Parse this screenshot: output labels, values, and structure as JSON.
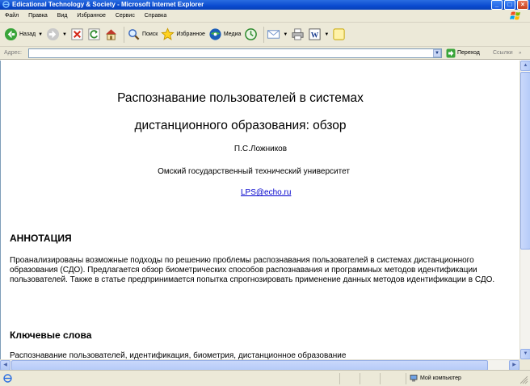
{
  "window": {
    "title": "Edicational Technology & Society - Microsoft Internet Explorer"
  },
  "menu": {
    "items": [
      "Файл",
      "Правка",
      "Вид",
      "Избранное",
      "Сервис",
      "Справка"
    ]
  },
  "toolbar": {
    "back_label": "Назад",
    "search_label": "Поиск",
    "favorites_label": "Избранное",
    "media_label": "Медиа"
  },
  "address": {
    "label": "Адрес:",
    "value": "",
    "go_label": "Переход",
    "links_label": "Ссылки"
  },
  "article": {
    "title_line1": "Распознавание пользователей в системах",
    "title_line2": "дистанционного образования: обзор",
    "author": "П.С.Ложников",
    "affiliation": "Омский государственный технический университет",
    "email": "LPS@echo.ru",
    "abstract_heading": "АННОТАЦИЯ",
    "abstract_text": "Проанализированы возможные подходы по решению проблемы распознавания пользователей в системах дистанционного образования (СДО). Предлагается обзор биометрических способов распознавания и программных методов идентификации пользователей. Также в статье предпринимается попытка спрогнозировать применение данных методов идентификации в СДО.",
    "keywords_heading": "Ключевые слова",
    "keywords_text": "Распознавание пользователей, идентификация, биометрия, дистанционное образование"
  },
  "status": {
    "text": "",
    "zone": "Мой компьютер"
  },
  "icons": {
    "titlebar": "ie-logo-icon",
    "back": "back-arrow-icon",
    "forward": "forward-arrow-icon",
    "stop": "stop-icon",
    "refresh": "refresh-icon",
    "home": "home-icon",
    "search": "search-icon",
    "favorites": "favorites-star-icon",
    "media": "media-icon",
    "history": "history-icon",
    "mail": "mail-icon",
    "print": "print-icon",
    "edit": "word-edit-icon",
    "messenger": "messenger-icon",
    "go": "go-arrow-icon",
    "status_page": "page-icon",
    "zone": "my-computer-icon"
  },
  "colors": {
    "titlebar": "#0a4bd0",
    "chrome": "#ece9d8",
    "link": "#0000cc"
  }
}
